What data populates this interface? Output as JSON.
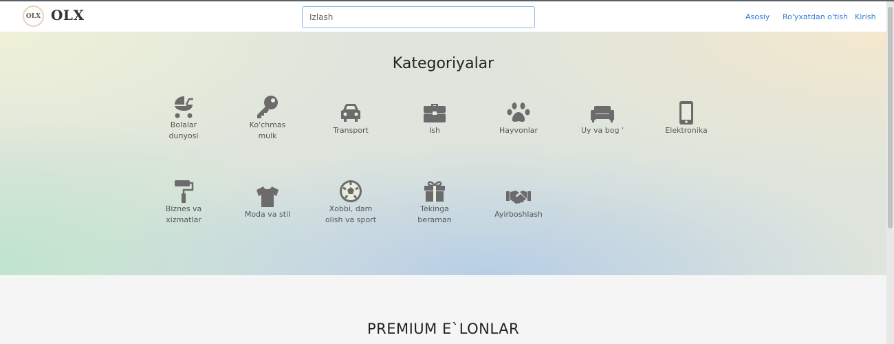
{
  "header": {
    "logo_badge": "OLX",
    "logo_text": "OLX",
    "search_placeholder": "Izlash",
    "nav": [
      "Asosiy",
      "Ro'yxatdan o'tish",
      "Kirish"
    ]
  },
  "hero": {
    "title": "Kategoriyalar",
    "categories": [
      {
        "label_lines": [
          "Bolalar",
          "dunyosi"
        ],
        "icon": "baby-carriage-icon"
      },
      {
        "label_lines": [
          "Ko'chmas",
          "mulk"
        ],
        "icon": "key-icon"
      },
      {
        "label_lines": [
          "Transport"
        ],
        "icon": "car-icon"
      },
      {
        "label_lines": [
          "Ish"
        ],
        "icon": "briefcase-icon"
      },
      {
        "label_lines": [
          "Hayvonlar"
        ],
        "icon": "paw-icon"
      },
      {
        "label_lines": [
          "Uy va bog '"
        ],
        "icon": "sofa-icon"
      },
      {
        "label_lines": [
          "Elektronika"
        ],
        "icon": "mobile-phone-icon"
      },
      {
        "label_lines": [
          "Biznes va",
          "xizmatlar"
        ],
        "icon": "paint-roller-icon"
      },
      {
        "label_lines": [
          "Moda va stil"
        ],
        "icon": "tshirt-icon"
      },
      {
        "label_lines": [
          "Xobbi, dam",
          "olish va sport"
        ],
        "icon": "soccer-ball-icon"
      },
      {
        "label_lines": [
          "Tekinga",
          "beraman"
        ],
        "icon": "gift-icon"
      },
      {
        "label_lines": [
          "Ayirboshlash"
        ],
        "icon": "handshake-icon"
      }
    ]
  },
  "premium_title": "PREMIUM E`LONLAR",
  "colors": {
    "link": "#2f80d6",
    "icon": "#6b6b6b"
  }
}
